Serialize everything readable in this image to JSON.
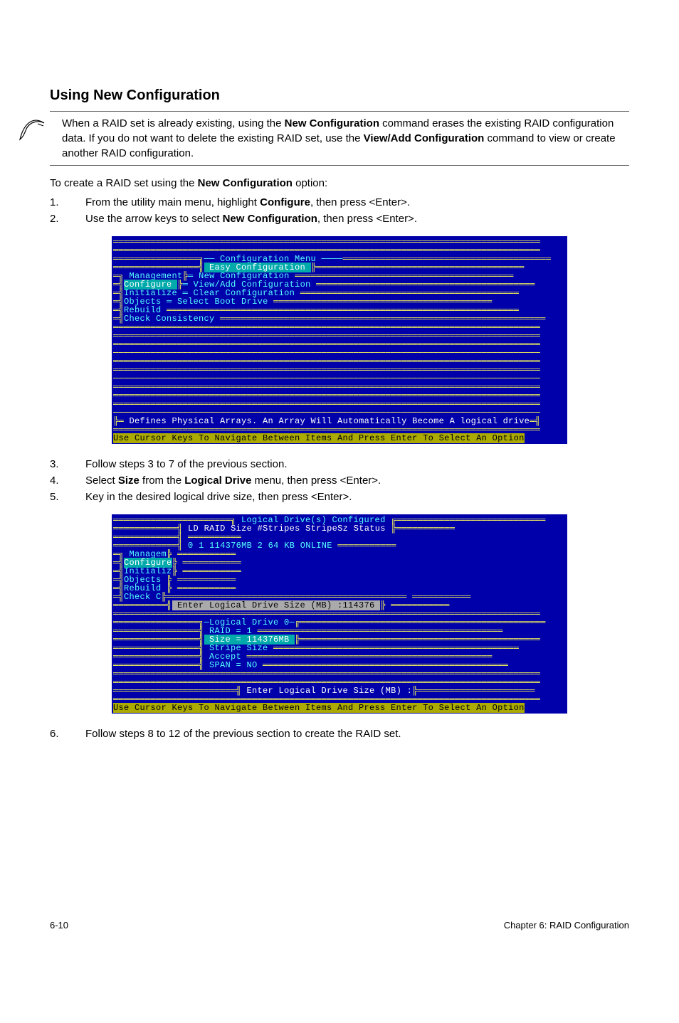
{
  "heading": "Using New Configuration",
  "note": {
    "text_a": "When a RAID set is already existing, using the ",
    "text_b": " command erases the existing RAID configuration data. If you do not want to delete the existing RAID set, use the ",
    "text_c": " command to view or create another RAID configuration.",
    "bold1": "New Configuration",
    "bold2": "View/Add Configuration"
  },
  "intro": {
    "pre": "To create a RAID set using the ",
    "bold": "New Configuration",
    "post": " option:"
  },
  "steps1": [
    {
      "num": "1.",
      "pre": "From the utility main menu, highlight ",
      "b1": "Configure",
      "mid": ", then press <Enter>."
    },
    {
      "num": "2.",
      "pre": "Use the arrow keys to select ",
      "b1": "New Configuration",
      "mid": ", then press <Enter>."
    }
  ],
  "screen1": {
    "header": "── Configuration Menu ────",
    "easy": " Easy Configuration     ",
    "management": " Management",
    "new_cfg": "New Configuration",
    "configure": "Configure",
    "viewadd": "View/Add Configuration",
    "initialize": "Initialize",
    "clear": "Clear Configuration",
    "objects": "Objects",
    "selboot": "Select Boot Drive",
    "rebuild": "Rebuild",
    "check": "Check Consistency",
    "help1": " Defines Physical Arrays. An Array Will Automatically Become A logical drive",
    "help2": "Use Cursor Keys To Navigate Between Items And Press Enter To Select An Option "
  },
  "steps2": [
    {
      "num": "3.",
      "text": "Follow steps 3 to 7 of the previous section."
    },
    {
      "num": "4.",
      "pre": "Select ",
      "b1": "Size",
      "mid": " from the ",
      "b2": "Logical Drive",
      "post": " menu, then press <Enter>."
    },
    {
      "num": "5.",
      "text": "Key in the desired logical drive size, then press <Enter>."
    }
  ],
  "screen2": {
    "title": " Logical Drive(s) Configured ",
    "cols": {
      "ld": "LD",
      "raid": "RAID",
      "size": "Size",
      "stripes": "#Stripes",
      "stripesz": "StripeSz",
      "status": "Status"
    },
    "row": {
      "ld": "0",
      "raid": "1",
      "size": "114376MB",
      "stripes": "2",
      "stripesz": "64",
      "unit": "KB",
      "status": "ONLINE"
    },
    "menu": {
      "management": "Managem",
      "configure": "Configure",
      "initialize": "Initializ",
      "objects": "Objects",
      "rebuild": "Rebuild",
      "check": "Check C"
    },
    "enterbox": " Enter Logical Drive Size (MB) :114376                ",
    "ldmenu": {
      "title": "─Logical Drive 0─",
      "raid": "RAID = 1",
      "size": " Size = 114376MB ",
      "stripe": "Stripe Size",
      "accept": "Accept",
      "span": "SPAN = NO"
    },
    "prompt": " Enter Logical Drive Size (MB) :",
    "help": "Use Cursor Keys To Navigate Between Items And Press Enter To Select An Option "
  },
  "step6": {
    "num": "6.",
    "text": "Follow steps 8 to 12 of the previous section to create the RAID set."
  },
  "footer": {
    "page": "6-10",
    "chapter": "Chapter 6: RAID Configuration"
  }
}
